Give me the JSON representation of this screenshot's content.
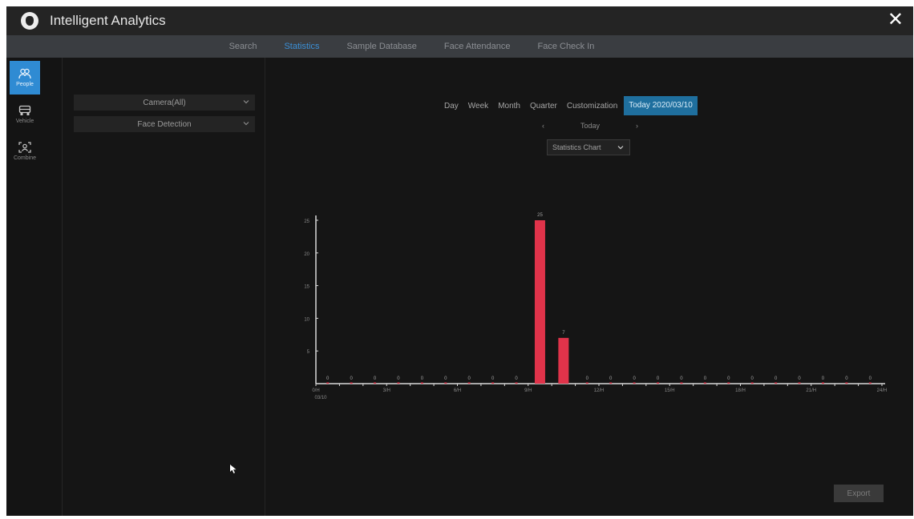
{
  "app": {
    "title": "Intelligent Analytics",
    "close_label": "✕"
  },
  "tabs": [
    {
      "label": "Search",
      "active": false
    },
    {
      "label": "Statistics",
      "active": true
    },
    {
      "label": "Sample Database",
      "active": false
    },
    {
      "label": "Face Attendance",
      "active": false
    },
    {
      "label": "Face Check In",
      "active": false
    }
  ],
  "sidebar": {
    "items": [
      {
        "label": "People",
        "icon": "people-icon",
        "active": true
      },
      {
        "label": "Vehicle",
        "icon": "vehicle-icon",
        "active": false
      },
      {
        "label": "Combine",
        "icon": "combine-icon",
        "active": false
      }
    ]
  },
  "filters": {
    "camera": "Camera(All)",
    "event": "Face Detection"
  },
  "periods": {
    "options": [
      "Day",
      "Week",
      "Month",
      "Quarter",
      "Customization"
    ],
    "today_label": "Today 2020/03/10"
  },
  "nav": {
    "prev": "‹",
    "label": "Today",
    "next": "›"
  },
  "chart_type": "Statistics Chart",
  "export_label": "Export",
  "colors": {
    "bar": "#e0334a",
    "axis": "#d9d9d9",
    "accent": "#2f8bd3"
  },
  "chart_data": {
    "type": "bar",
    "x": [
      0,
      1,
      2,
      3,
      4,
      5,
      6,
      7,
      8,
      9,
      10,
      11,
      12,
      13,
      14,
      15,
      16,
      17,
      18,
      19,
      20,
      21,
      22,
      23,
      24
    ],
    "values": [
      0,
      0,
      0,
      0,
      0,
      0,
      0,
      0,
      0,
      25,
      7,
      0,
      0,
      0,
      0,
      0,
      0,
      0,
      0,
      0,
      0,
      0,
      0,
      0,
      0
    ],
    "x_tick_labels": [
      "0/H",
      "3/H",
      "6/H",
      "9/H",
      "12/H",
      "15/H",
      "18/H",
      "21/H",
      "24/H"
    ],
    "x_date_label": "03/10",
    "y_ticks": [
      5,
      10,
      15,
      20,
      25
    ],
    "ylim": [
      0,
      25
    ],
    "color": "#e0334a"
  }
}
